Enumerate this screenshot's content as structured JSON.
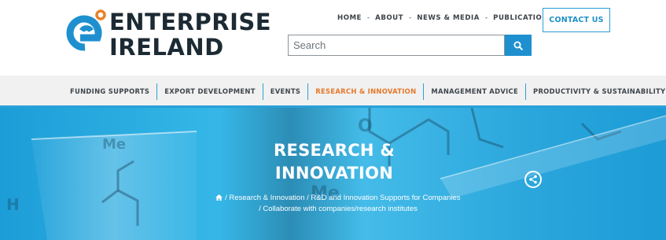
{
  "brand": {
    "line1": "ENTERPRISE",
    "line2": "IRELAND",
    "accent": "#1e90d0",
    "dot": "#e8822a"
  },
  "top_nav": {
    "items": [
      "HOME",
      "ABOUT",
      "NEWS & MEDIA",
      "PUBLICATIONS"
    ],
    "separator": "-"
  },
  "contact_button": "CONTACT US",
  "search": {
    "placeholder": "Search",
    "icon": "search-icon"
  },
  "main_nav": {
    "items": [
      "FUNDING SUPPORTS",
      "EXPORT DEVELOPMENT",
      "EVENTS",
      "RESEARCH & INNOVATION",
      "MANAGEMENT ADVICE",
      "PRODUCTIVITY & SUSTAINABILITY"
    ],
    "active": "RESEARCH & INNOVATION",
    "active_color": "#e5782a",
    "underline_color": "#2aa0d8"
  },
  "hero": {
    "title_line1": "RESEARCH &",
    "title_line2": "INNOVATION",
    "breadcrumb": {
      "home_icon": "home-icon",
      "items": [
        "Research & Innovation",
        "R&D and Innovation Supports for Companies",
        "Collaborate with companies/research institutes"
      ],
      "separator": "/"
    },
    "share_icon": "share-icon"
  }
}
